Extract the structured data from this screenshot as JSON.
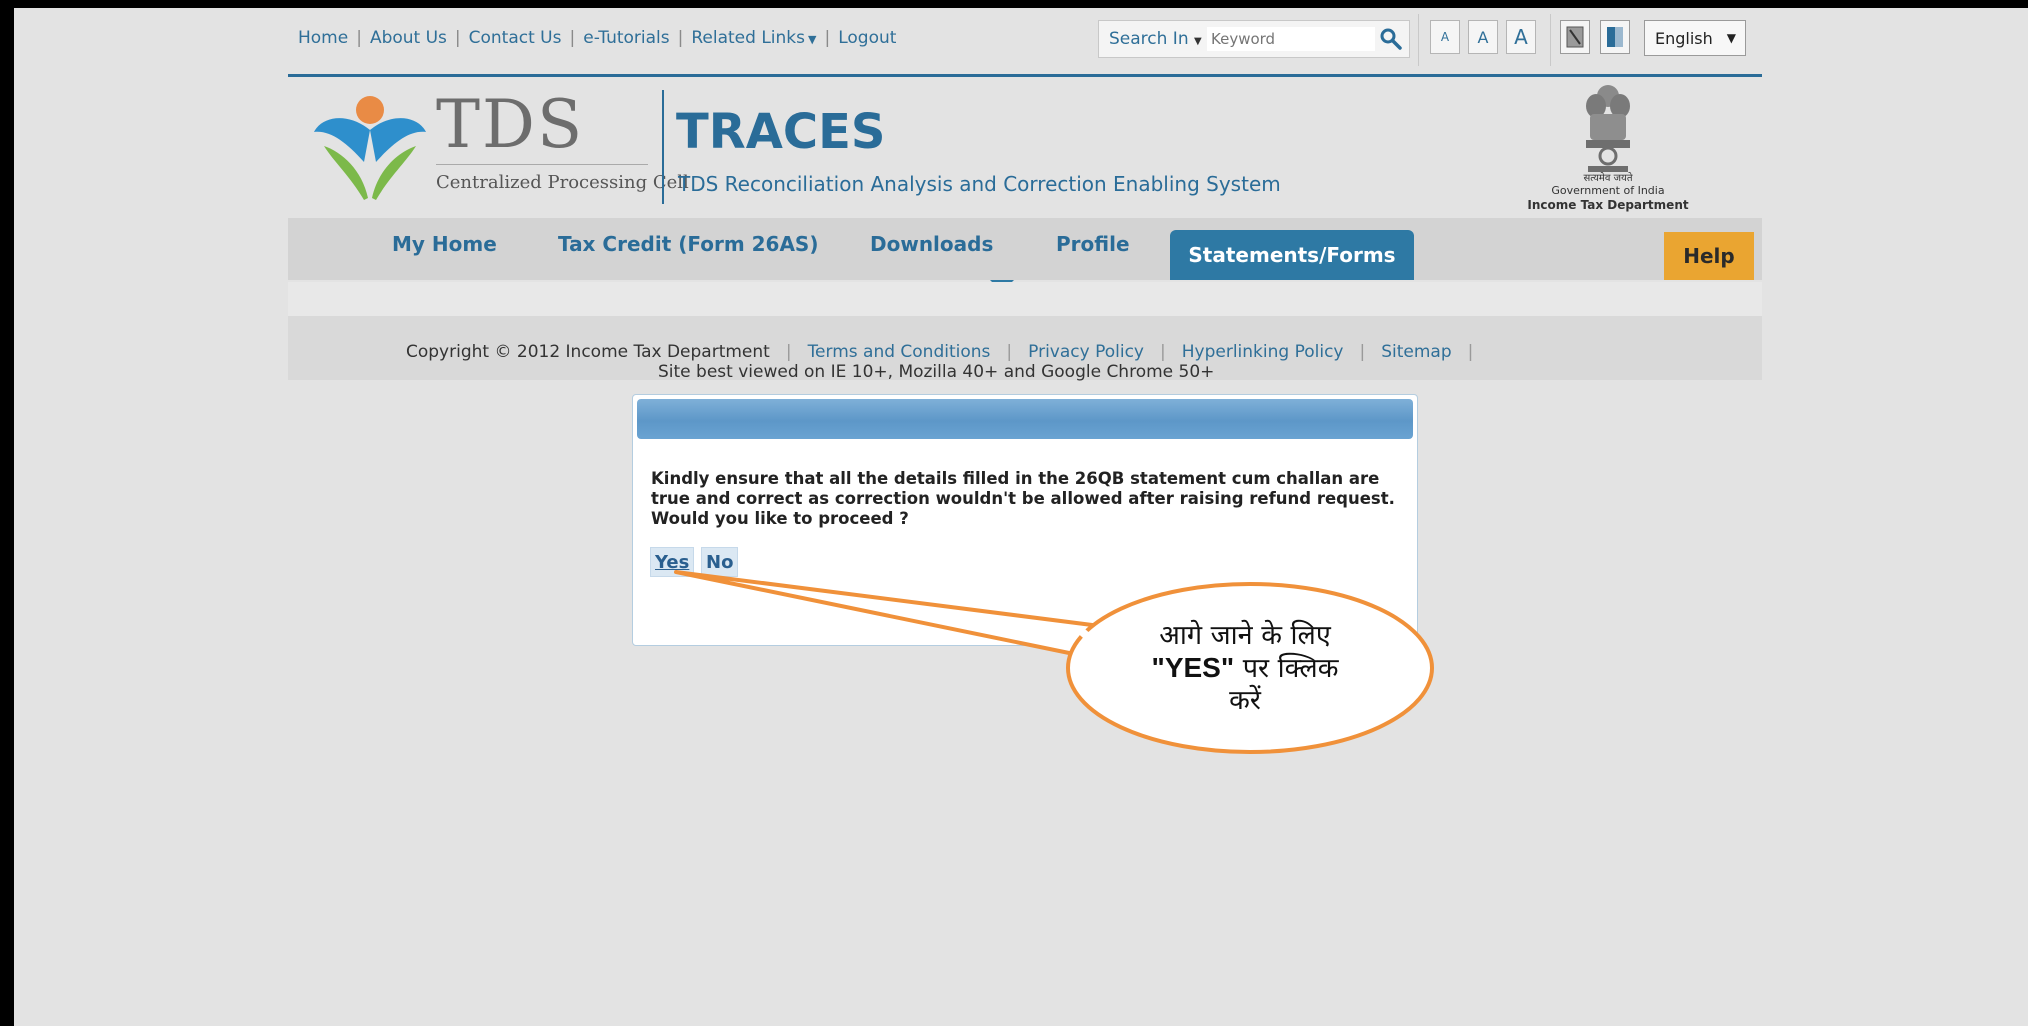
{
  "toplinks": {
    "home": "Home",
    "about": "About Us",
    "contact": "Contact Us",
    "tutorials": "e-Tutorials",
    "related": "Related Links",
    "logout": "Logout"
  },
  "search": {
    "scope_label": "Search In",
    "placeholder": "Keyword"
  },
  "font_size": {
    "small": "A",
    "medium": "A",
    "large": "A"
  },
  "language": {
    "selected": "English"
  },
  "header": {
    "logo_text": "TDS",
    "logo_sub": "Centralized Processing Cell",
    "title": "TRACES",
    "subtitle": "TDS Reconciliation Analysis and Correction Enabling System",
    "gov_motto": "सत्यमेव जयते",
    "gov_line": "Government of India",
    "gov_dept": "Income Tax Department"
  },
  "nav": {
    "items": [
      "My Home",
      "Tax Credit (Form 26AS)",
      "Downloads",
      "Profile"
    ],
    "active": "Statements/Forms",
    "help": "Help"
  },
  "footer": {
    "copyright": "Copyright © 2012 Income Tax Department",
    "links": [
      "Terms and Conditions",
      "Privacy Policy",
      "Hyperlinking Policy",
      "Sitemap"
    ],
    "browser_note": "Site best viewed on IE 10+, Mozilla 40+ and Google Chrome 50+"
  },
  "dialog": {
    "message": "Kindly ensure that all the details filled in the 26QB statement cum challan are true and correct as correction wouldn't be allowed after raising refund request. Would you like to proceed ?",
    "yes_label": "Yes",
    "no_label": "No"
  },
  "callout": {
    "line1": "आगे जाने के लिए",
    "bold": "\"YES\"",
    "line2_rest": "पर क्लिक",
    "line3": "करें"
  },
  "colors": {
    "brand_blue": "#2a6c98",
    "active_tab": "#2e79a4",
    "help_orange": "#eaa531",
    "callout_orange": "#f0913a"
  }
}
